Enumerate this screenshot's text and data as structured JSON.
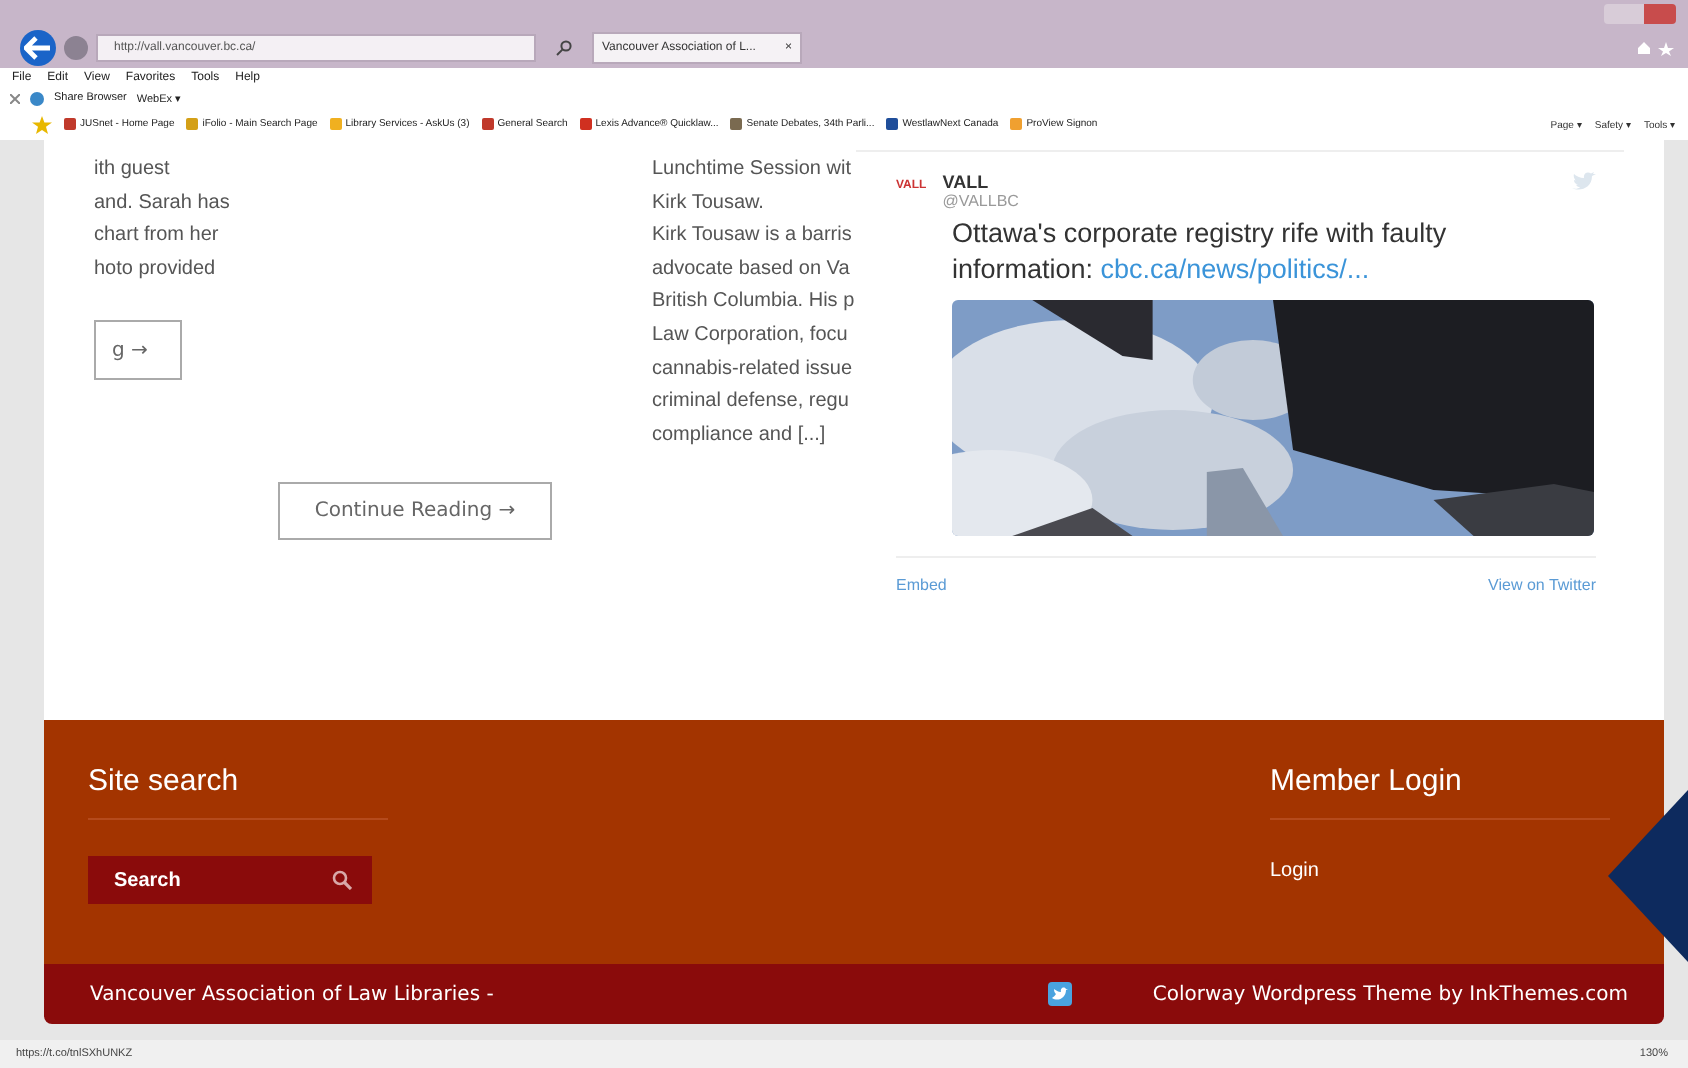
{
  "browser": {
    "address": "http://vall.vancouver.bc.ca/",
    "tab": {
      "title": "Vancouver Association of L...",
      "close": "×",
      "selected": true
    },
    "menu": [
      "File",
      "Edit",
      "View",
      "Favorites",
      "Tools",
      "Help"
    ],
    "share_bar": [
      "Share Browser",
      "WebEx ▾"
    ],
    "favorites": [
      {
        "label": "JUSnet - Home Page",
        "color": "#c0392b"
      },
      {
        "label": "iFolio - Main Search Page",
        "color": "#d4a017"
      },
      {
        "label": "Library Services - AskUs (3)",
        "color": "#f0b020"
      },
      {
        "label": "General Search",
        "color": "#c0392b"
      },
      {
        "label": "Lexis Advance® Quicklaw...",
        "color": "#d03020"
      },
      {
        "label": "Senate Debates, 34th Parli...",
        "color": "#7a6a50"
      },
      {
        "label": "WestlawNext Canada",
        "color": "#1f4e9a"
      },
      {
        "label": "ProView Signon",
        "color": "#f0a030"
      }
    ],
    "commands": [
      "Page ▾",
      "Safety ▾",
      "Tools ▾"
    ]
  },
  "left_post": {
    "lines": [
      "ith guest",
      "and. Sarah has",
      "chart from her",
      "hoto provided"
    ],
    "button": "g →"
  },
  "continue_button": "Continue Reading →",
  "middle_post": {
    "lines": [
      "Lunchtime Session wit",
      "Kirk Tousaw.",
      "Kirk Tousaw is a barris",
      "advocate based on Va",
      "British Columbia. His p",
      "Law Corporation, focu",
      "cannabis-related issue",
      "criminal defense, regu",
      "compliance and [...]"
    ]
  },
  "tweet": {
    "name": "VALL",
    "handle": "@VALLBC",
    "logo": "VALL",
    "text": "Ottawa's corporate registry rife with faulty information:",
    "link": "cbc.ca/news/politics/...",
    "embed": "Embed",
    "view": "View on Twitter"
  },
  "footer": {
    "search_title": "Site search",
    "search_placeholder": "Search",
    "login_title": "Member Login",
    "login_link": "Login",
    "credit": "Vancouver Association of Law Libraries -",
    "theme": "Colorway Wordpress Theme by InkThemes.com"
  },
  "status_bar": {
    "url": "https://t.co/tnlSXhUNKZ",
    "zoom": "130%"
  }
}
